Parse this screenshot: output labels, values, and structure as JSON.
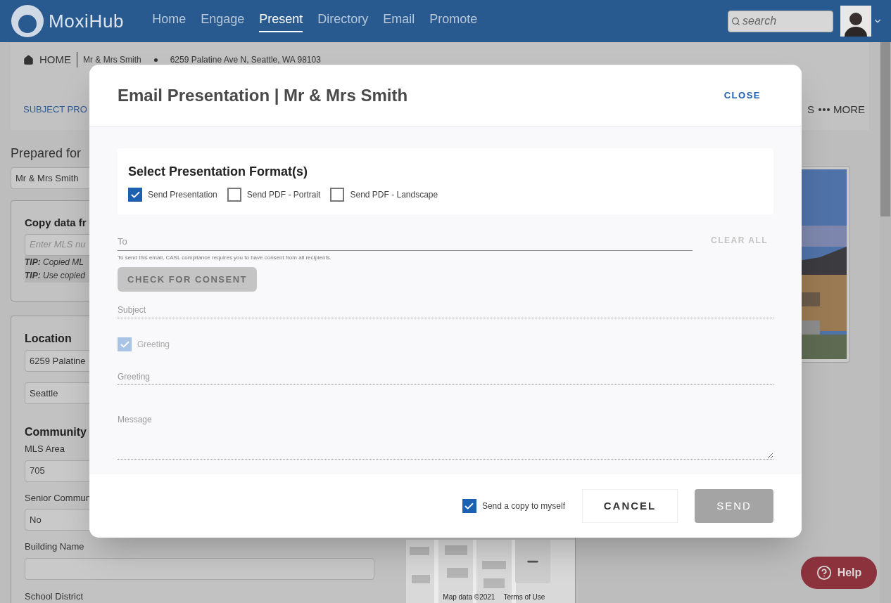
{
  "header": {
    "logo": "MoxiHub",
    "nav": [
      {
        "label": "Home",
        "selected": false
      },
      {
        "label": "Engage",
        "selected": false
      },
      {
        "label": "Present",
        "selected": true
      },
      {
        "label": "Directory",
        "selected": false
      },
      {
        "label": "Email",
        "selected": false
      },
      {
        "label": "Promote",
        "selected": false
      }
    ],
    "search": {
      "placeholder": "search"
    }
  },
  "breadcrumb": {
    "home": "HOME",
    "client": "Mr & Mrs Smith",
    "address": "6259 Palatine Ave N, Seattle, WA 98103"
  },
  "subnav": {
    "left": "SUBJECT PRO",
    "right_fragment": "S",
    "more": "MORE"
  },
  "form": {
    "prepared_for": {
      "label": "Prepared for",
      "value": "Mr & Mrs Smith"
    },
    "copy_data": {
      "title": "Copy data fr",
      "placeholder": "Enter MLS nu",
      "tips": [
        "**TIP:** Copied ML",
        "**TIP:** Use copied"
      ]
    },
    "location": {
      "title": "Location",
      "address": "6259 Palatine",
      "city": "Seattle"
    },
    "community": {
      "title": "Community",
      "fields": [
        {
          "label": "MLS Area",
          "value": "705"
        },
        {
          "label": "Senior Commun",
          "value": "No"
        },
        {
          "label": "Building Name"
        }
      ],
      "last_label": "School District"
    }
  },
  "map": {
    "attribution": "Map data ©2021",
    "terms": "Terms of Use"
  },
  "help_button": "Help",
  "modal": {
    "title": "Email Presentation | Mr & Mrs Smith",
    "close": "CLOSE",
    "formats": {
      "title": "Select Presentation Format(s)",
      "options": [
        {
          "label": "Send Presentation",
          "checked": true
        },
        {
          "label": "Send PDF - Portrait",
          "checked": false
        },
        {
          "label": "Send PDF - Landscape",
          "checked": false
        }
      ]
    },
    "to": {
      "placeholder": "To"
    },
    "clear_all": "CLEAR ALL",
    "consent_note": "To send this email, CASL compliance requires you to have consent from all recipients.",
    "consent_button": {
      "label": "CHECK FOR CONSENT",
      "disabled": true
    },
    "subject": {
      "placeholder": "Subject"
    },
    "greeting_toggle": {
      "label": "Greeting",
      "checked": true,
      "disabled": true
    },
    "greeting": {
      "placeholder": "Greeting"
    },
    "message": {
      "placeholder": "Message"
    },
    "copy_to_self": {
      "label": "Send a copy to myself",
      "checked": true
    },
    "cancel": "CANCEL",
    "send": {
      "label": "SEND",
      "disabled": true
    }
  }
}
